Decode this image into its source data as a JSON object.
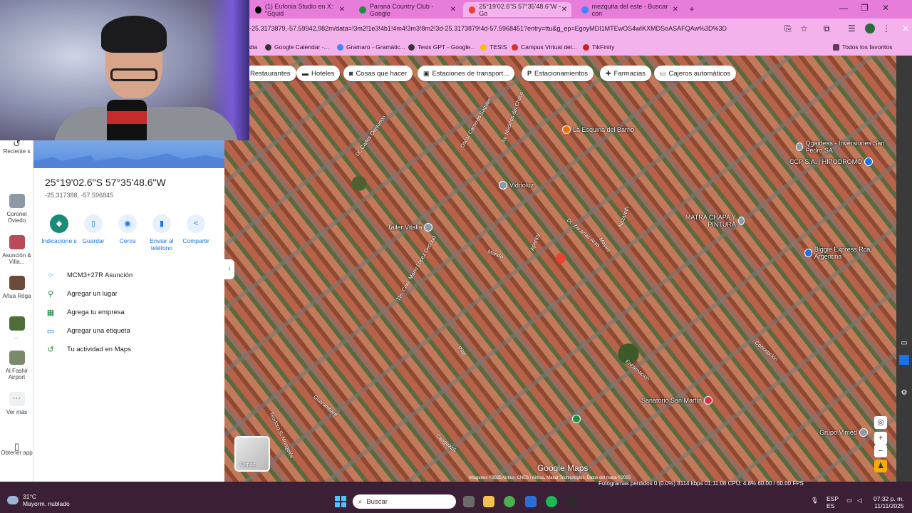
{
  "tabs": [
    {
      "label": "(1) Eufonia Studio en X: \"Squid",
      "favicon_color": "#000000"
    },
    {
      "label": "Paraná Country Club - Google",
      "favicon_color": "#1e8e3e"
    },
    {
      "label": "25°19'02.6\"S 57°35'48.6\"W - Go",
      "favicon_color": "#ea4335"
    },
    {
      "label": "mezquita del este - Buscar con",
      "favicon_color": "#4285f4"
    }
  ],
  "address": {
    "url": "-25.3173879,-57.59942,982m/data=!3m2!1e3!4b1!4m4!3m3!8m2!3d-25.3173879!4d-57.5968451?entry=ttu&g_ep=EgoyMDI1MTEwOS4wIKXMDSoASAFQAw%3D%3D"
  },
  "bookmarks": [
    {
      "label": "dia"
    },
    {
      "label": "Google Calendar -..."
    },
    {
      "label": "Gramaro - Gramátic..."
    },
    {
      "label": "Tesis GPT - Google..."
    },
    {
      "label": "TESIS"
    },
    {
      "label": "Campus Virtual del..."
    },
    {
      "label": "TikFinity"
    },
    {
      "label": "Todos los favoritos"
    }
  ],
  "rail": {
    "recientes": "Reciente s",
    "items": [
      {
        "label": "Coronel Oviedo"
      },
      {
        "label": "Asunción & Villa..."
      },
      {
        "label": "Añua Róga"
      },
      {
        "label": "..."
      },
      {
        "label": "Al Fashir Airport"
      },
      {
        "label": "Ver más"
      }
    ],
    "getapp": "Obtener app"
  },
  "panel": {
    "title": "25°19'02.6\"S 57°35'48.6\"W",
    "subtitle": "-25.317388, -57.596845",
    "actions": [
      {
        "label": "Indicacione s"
      },
      {
        "label": "Guardar"
      },
      {
        "label": "Cerca"
      },
      {
        "label": "Enviar al teléfono"
      },
      {
        "label": "Compartir"
      }
    ],
    "list": [
      {
        "label": "MCM3+27R Asunción"
      },
      {
        "label": "Agregar un lugar"
      },
      {
        "label": "Agrega tu empresa"
      },
      {
        "label": "Agregar una etiqueta"
      },
      {
        "label": "Tu actividad en Maps"
      }
    ]
  },
  "chips": [
    {
      "label": "Restaurantes"
    },
    {
      "label": "Hoteles"
    },
    {
      "label": "Cosas que hacer"
    },
    {
      "label": "Estaciones de transport..."
    },
    {
      "label": "Estacionamientos"
    },
    {
      "label": "Farmacias"
    },
    {
      "label": "Cajeros automáticos"
    }
  ],
  "pois": [
    {
      "label": "La Esquina del Barrio"
    },
    {
      "label": "Vidrioluz"
    },
    {
      "label": "Qgaideas - Inversiones San Pedro SA"
    },
    {
      "label": "CCP S.A. | HIPODROMO"
    },
    {
      "label": "MATRA CHAPA Y PINTURA"
    },
    {
      "label": "Taller Vitalia"
    },
    {
      "label": "Biggie Express Rca. Argentina"
    },
    {
      "label": "Sanatorio San Martín"
    },
    {
      "label": "Grupo Vimed"
    }
  ],
  "streets": [
    {
      "label": "Dr. Carlos Centurion"
    },
    {
      "label": "Oscar Carreras Saguier"
    },
    {
      "label": "Av. Médicos del Chaco"
    },
    {
      "label": "Tte. Cnel. Mario López Decoud"
    },
    {
      "label": "Mayas"
    },
    {
      "label": "Nazareth"
    },
    {
      "label": "Guarambare"
    },
    {
      "label": "Pilar"
    },
    {
      "label": "Encarnacion"
    },
    {
      "label": "Concepción"
    },
    {
      "label": "Aparipy"
    },
    {
      "label": "Mandú"
    },
    {
      "label": "Dr. Zacarías Arza"
    },
    {
      "label": "Caaguazú"
    },
    {
      "label": "Teodoro S. Mongelós"
    }
  ],
  "map": {
    "layers": "Capas",
    "logo": "Google Maps",
    "attribution": "Imágenes ©2025 Airbus, CNES / Airbus, Maxar Technologies, Datos del mapa ©2025"
  },
  "obs": {
    "text": "Fotogramas perdidos 0 (0.0%)   8114 kbps   01:11:08   CPU: 4.8%   60.00 / 60.00 FPS"
  },
  "taskbar": {
    "temp": "31°C",
    "weather": "Mayorm. nublado",
    "search": "Buscar",
    "lang": "ESP",
    "lang2": "ES",
    "time": "07:32 p. m.",
    "date": "11/11/2025"
  },
  "colors": {
    "tabstrip": "#e87cdb",
    "toolbar": "#f4b2ec",
    "taskbar": "#3b1f35",
    "maps_blue": "#1a73e8",
    "marker_red": "#ea4335"
  }
}
